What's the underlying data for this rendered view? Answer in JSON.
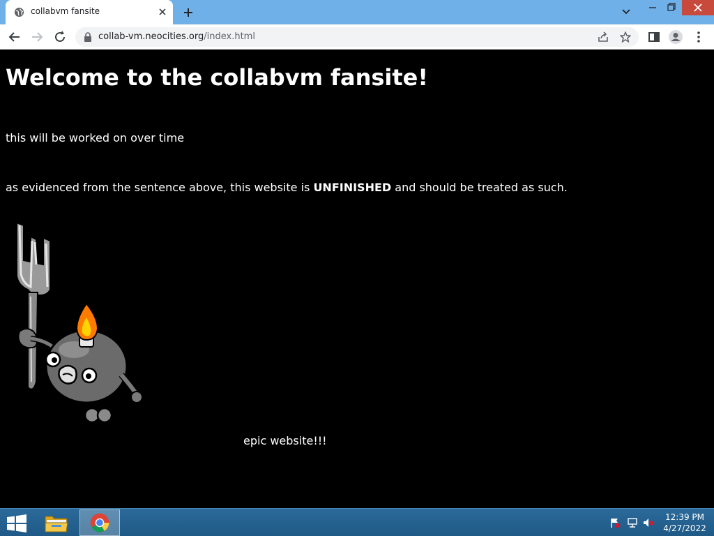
{
  "browser": {
    "tab_title": "collabvm fansite",
    "url_host": "collab-vm.neocities.org",
    "url_path": "/index.html"
  },
  "page": {
    "heading": "Welcome to the collabvm fansite!",
    "paragraph1": "this will be worked on over time",
    "paragraph2_before": "as evidenced from the sentence above, this website is ",
    "paragraph2_bold": "UNFINISHED",
    "paragraph2_after": " and should be treated as such.",
    "caption": "epic website!!!"
  },
  "taskbar": {
    "time": "12:39 PM",
    "date": "4/27/2022"
  },
  "colors": {
    "tabbar": "#6fb0e8",
    "page_background": "#000000",
    "page_text": "#ffffff",
    "taskbar": "#1f5986",
    "close_button": "#c74a3c"
  },
  "icons": [
    "globe-icon",
    "close-icon",
    "plus-icon",
    "chevron-down-icon",
    "minimize-icon",
    "restore-icon",
    "back-arrow-icon",
    "forward-arrow-icon",
    "reload-icon",
    "lock-icon",
    "share-icon",
    "star-icon",
    "side-panel-icon",
    "profile-icon",
    "kebab-menu-icon",
    "windows-logo-icon",
    "folder-icon",
    "chrome-icon",
    "action-center-flag-icon",
    "network-icon",
    "volume-muted-icon"
  ]
}
